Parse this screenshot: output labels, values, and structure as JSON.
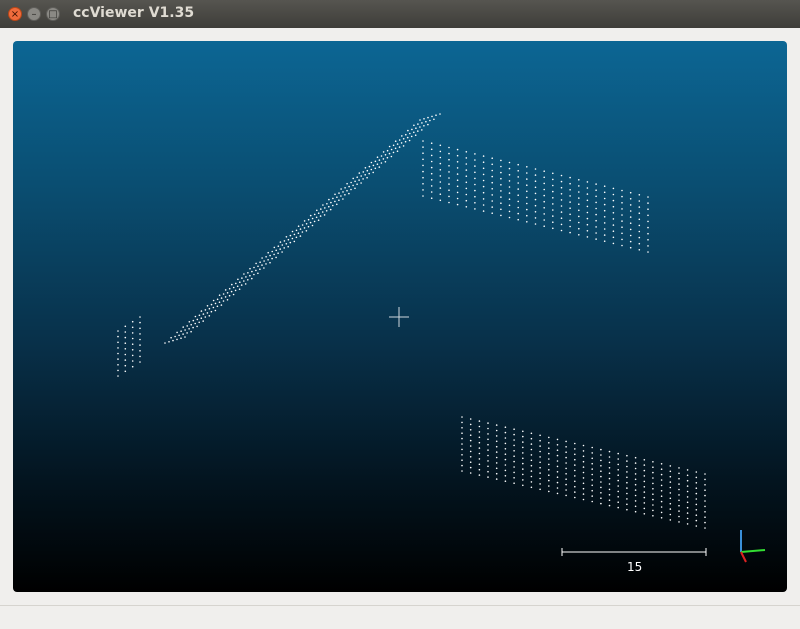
{
  "window": {
    "title": "ccViewer V1.35",
    "controls": {
      "close": "×",
      "minimize": "–",
      "maximize": "□"
    }
  },
  "viewport": {
    "background_top": "#0c6694",
    "background_bottom": "#000000",
    "point_color": "#ffffff",
    "scale_bar_label": "15",
    "axis_colors": {
      "x": "#33dd33",
      "y": "#3a8fd8",
      "z": "#dd2222"
    }
  },
  "statusbar": {
    "text": ""
  }
}
